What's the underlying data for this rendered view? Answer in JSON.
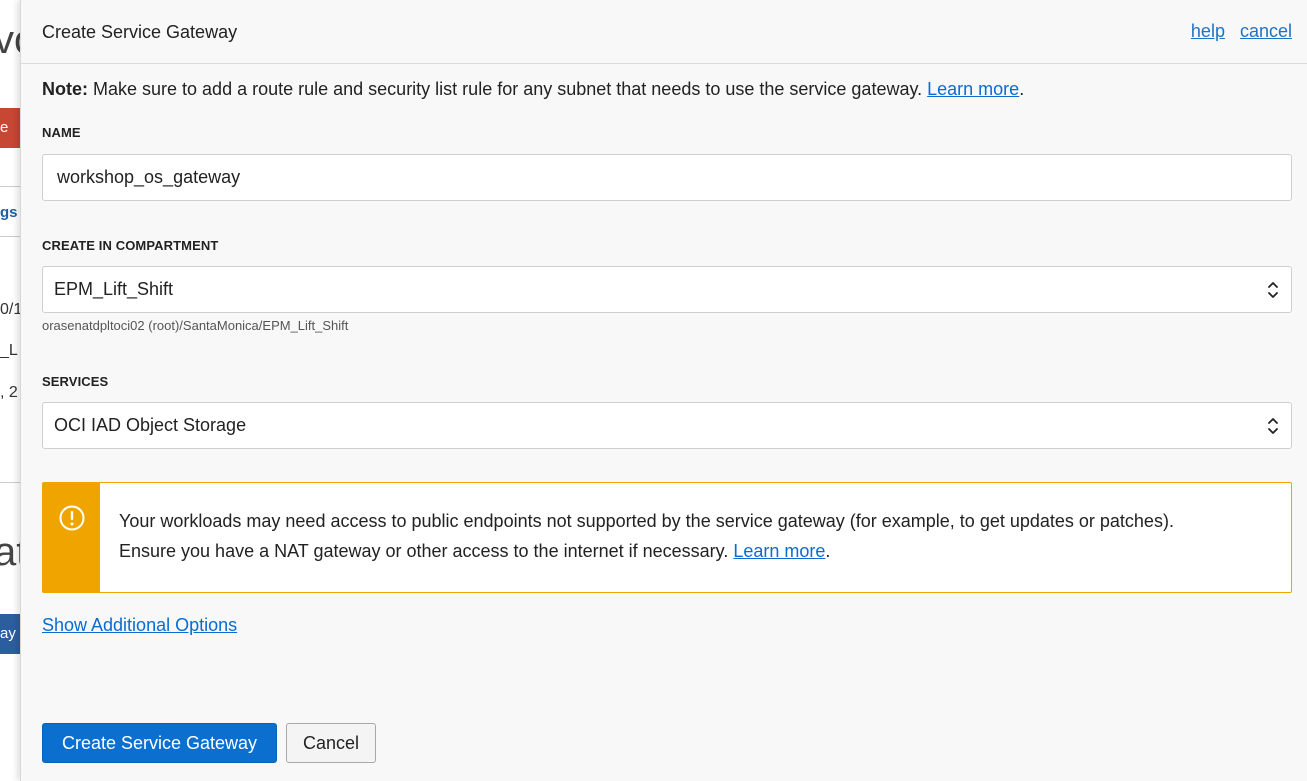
{
  "background": {
    "fragments": [
      "vo",
      "e",
      "gs",
      "0/1",
      "_L",
      ", 2",
      "at",
      "ay"
    ]
  },
  "dialog": {
    "title": "Create Service Gateway",
    "help_label": "help",
    "cancel_label": "cancel"
  },
  "note": {
    "prefix": "Note:",
    "text": " Make sure to add a route rule and security list rule for any subnet that needs to use the service gateway. ",
    "link": "Learn more",
    "suffix": "."
  },
  "name_field": {
    "label": "NAME",
    "value": "workshop_os_gateway"
  },
  "compartment_field": {
    "label": "CREATE IN COMPARTMENT",
    "value": "EPM_Lift_Shift",
    "hint": "orasenatdpltoci02 (root)/SantaMonica/EPM_Lift_Shift"
  },
  "services_field": {
    "label": "SERVICES",
    "value": "OCI IAD Object Storage"
  },
  "warning": {
    "icon": "exclamation-circle-icon",
    "color": "#f0a400",
    "text_line1": "Your workloads may need access to public endpoints not supported by the service gateway (for example, to get updates or patches).",
    "text_line2": "Ensure you have a NAT gateway or other access to the internet if necessary. ",
    "link": "Learn more",
    "suffix": "."
  },
  "show_additional_options": "Show Additional Options",
  "buttons": {
    "create_label": "Create Service Gateway",
    "cancel_label": "Cancel",
    "primary_color": "#0b6fcf"
  }
}
